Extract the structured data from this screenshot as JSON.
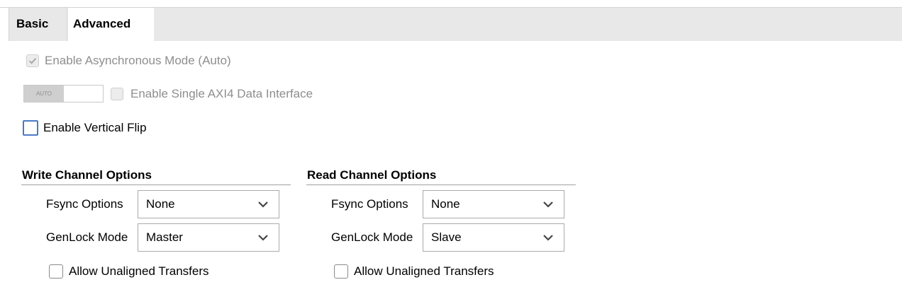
{
  "tabs": [
    {
      "label": "Basic",
      "active": false
    },
    {
      "label": "Advanced",
      "active": true
    }
  ],
  "options": {
    "async_mode": {
      "label": "Enable Asynchronous Mode (Auto)",
      "checked": true,
      "enabled": false
    },
    "auto_toggle": {
      "label": "AUTO"
    },
    "single_axi4": {
      "label": "Enable Single AXI4 Data Interface",
      "checked": false,
      "enabled": false
    },
    "vertical_flip": {
      "label": "Enable Vertical Flip",
      "checked": false,
      "enabled": true
    }
  },
  "write_channel": {
    "title": "Write Channel Options",
    "fsync_label": "Fsync Options",
    "fsync_value": "None",
    "genlock_label": "GenLock Mode",
    "genlock_value": "Master",
    "unaligned_label": "Allow Unaligned Transfers",
    "unaligned_checked": false
  },
  "read_channel": {
    "title": "Read Channel Options",
    "fsync_label": "Fsync Options",
    "fsync_value": "None",
    "genlock_label": "GenLock Mode",
    "genlock_value": "Slave",
    "unaligned_label": "Allow Unaligned Transfers",
    "unaligned_checked": false
  },
  "colors": {
    "focus": "#4a7ac6",
    "tab_bar": "#e8e8e8",
    "disabled_text": "#8e8e8e"
  },
  "icons": {
    "check": "check-icon",
    "chevron": "chevron-down-icon"
  }
}
